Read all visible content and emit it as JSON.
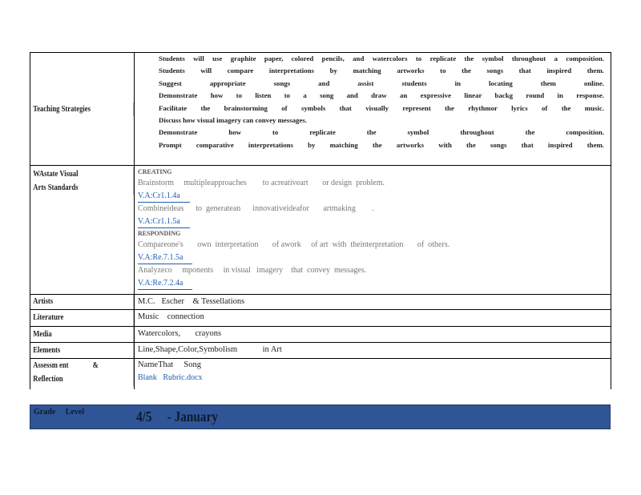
{
  "teaching": {
    "label": "Teaching       Strategies",
    "bullet": "",
    "items": [
      "Students will use graphite paper, colored pencils, and watercolors to replicate the symbol throughout a composition.",
      "Students will compare interpretations by matching artworks to the songs that inspired them.",
      "Suggest appropriate songs and assist students in locating them online.",
      "Demonstrate how to listen to a song and draw an expressive linear backg round in response.",
      "Facilitate the brainstorming of symbols that visually represent the rhythmor lyrics of the music.",
      "Discuss how visual imagery can convey messages.",
      "Demonstrate how to replicate the symbol throughout the composition.",
      "Prompt comparative interpretations by matching the artworks with the songs that inspired them."
    ]
  },
  "standards": {
    "label_line1": "WAstate          Visual",
    "label_line2": "Arts    Standards",
    "creating_heading": "CREATING",
    "creating_1_text": "Brainstorm     multipleapproaches        to acreativeart       or design  problem.",
    "creating_1_code": "V.A:Cr1.1.4a",
    "creating_2_text": "Combineideas      to  generatean      innovativeideafor       artmaking        .",
    "creating_2_code": "V.A:Cr1.1.5a",
    "responding_heading": "RESPONDING",
    "responding_1_text": "Compareone's       own  interpretation       of awork     of art  with  theinterpretation       of  others.",
    "responding_1_code": "V.A:Re.7.1.5a",
    "responding_2_text": "Analyzeco     mponents     in visual   imagery    that  convey  messages.",
    "responding_2_code": "V.A:Re.7.2.4a"
  },
  "artists": {
    "label": "Artists",
    "value": "M.C.   Escher    & Tessellations"
  },
  "literature": {
    "label": "Literature",
    "value": "Music    connection"
  },
  "media": {
    "label": "Media",
    "value": "Watercolors,       crayons"
  },
  "elements": {
    "label": "Elements",
    "value": "Line,Shape,Color,Symbolism            in Art"
  },
  "assessment": {
    "label_line1": "Assessm ent              &",
    "label_line2": "Reflection",
    "value": "NameThat     Song",
    "link": "Blank   Rubric.docx"
  },
  "grade": {
    "label": "Grade     Level",
    "value": "4/5     - January",
    "background": "#2f5597"
  }
}
